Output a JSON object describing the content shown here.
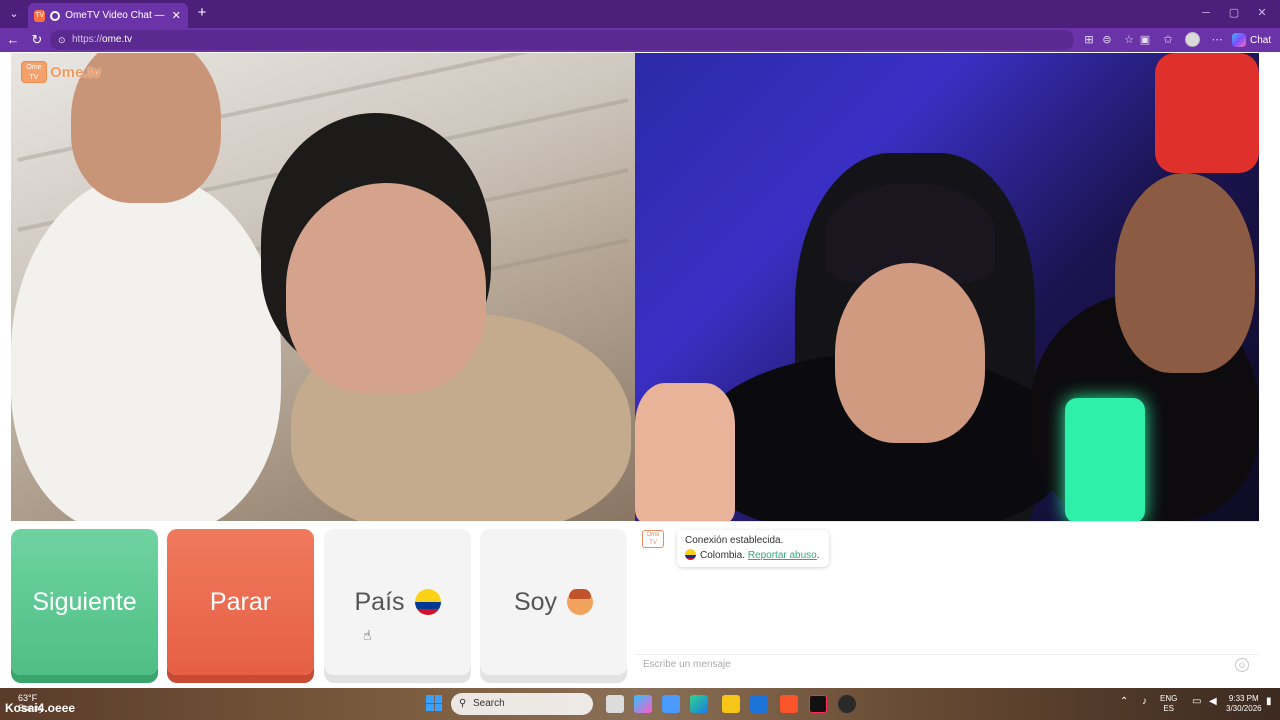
{
  "browser": {
    "tab_title": "OmeTV Video Chat — Omegle",
    "tab_favicon_text": "TV",
    "url_scheme": "https://",
    "url_host": "ome.tv",
    "chat_label": "Chat",
    "window_minimize": "─",
    "window_restore": "▢",
    "window_close": "✕"
  },
  "logo": {
    "box_text": "Ome TV",
    "text": "Ome.tv"
  },
  "controls": {
    "next_label": "Siguiente",
    "stop_label": "Parar",
    "country_label": "País",
    "gender_label": "Soy"
  },
  "chat": {
    "system_icon_text": "Ome TV",
    "connection_text": "Conexión establecida.",
    "country_text": "Colombia.",
    "report_link": "Reportar abuso",
    "report_suffix": ".",
    "input_placeholder": "Escribe un mensaje"
  },
  "taskbar": {
    "weather_temp": "63°F",
    "weather_desc": "Sunny",
    "watermark": "Kosai4.oeee",
    "watermark_k": "K",
    "search_label": "Search",
    "lang_top": "ENG",
    "lang_bottom": "ES",
    "time": "9:33 PM",
    "date": "3/30/2026"
  },
  "colors": {
    "browser_frame": "#4b1f7a",
    "next_button": "#5cc893",
    "stop_button": "#ea6a4e",
    "report_link": "#37a57a"
  }
}
